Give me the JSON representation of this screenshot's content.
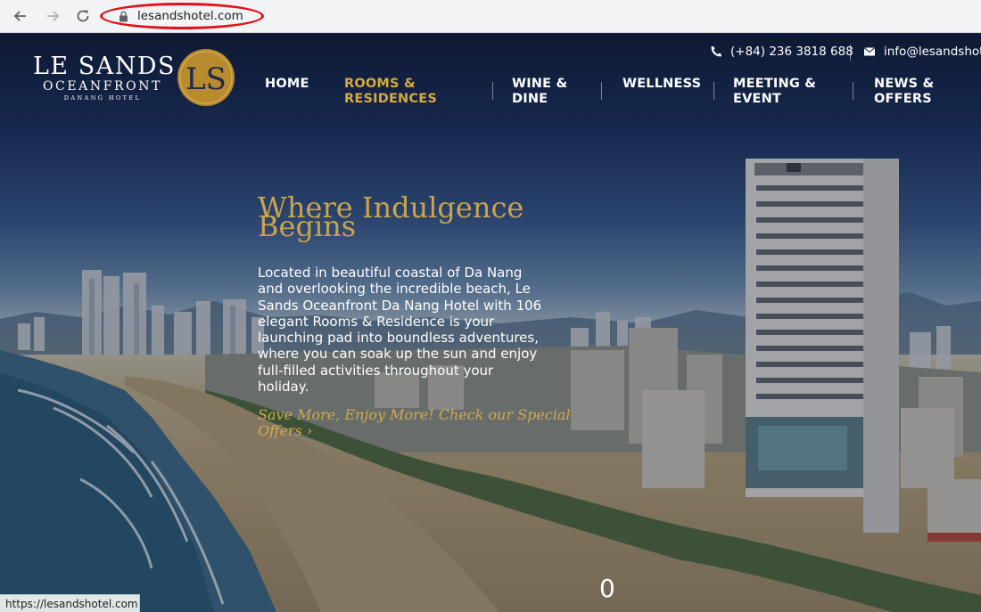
{
  "browser": {
    "url": "lesandshotel.com",
    "status_link": "https://lesandshotel.com"
  },
  "contact": {
    "phone": "(+84) 236 3818 688",
    "email": "info@lesandshotel.com"
  },
  "logo": {
    "line1": "LE SANDS",
    "line2": "OCEANFRONT",
    "line3": "DANANG HOTEL",
    "emblem_letters": "LS"
  },
  "nav": {
    "items": [
      {
        "line1": "HOME",
        "line2": ""
      },
      {
        "line1": "ROOMS &",
        "line2": "RESIDENCES"
      },
      {
        "line1": "WINE &",
        "line2": "DINE"
      },
      {
        "line1": "WELLNESS",
        "line2": ""
      },
      {
        "line1": "MEETING &",
        "line2": "EVENT"
      },
      {
        "line1": "NEWS &",
        "line2": "OFFERS"
      }
    ],
    "active_index": 1
  },
  "hero": {
    "title_lines": [
      "Where Indulgence",
      "Begins"
    ],
    "description_lines": [
      "Located in beautiful coastal of Da Nang",
      "and overlooking the incredible beach, Le",
      "Sands Oceanfront Da Nang Hotel with 106",
      "elegant Rooms & Residence is your",
      "launching pad into boundless adventures,",
      "where you can soak up the sun and enjoy",
      "full-filled activities throughout your",
      "holiday."
    ],
    "offers_lines": [
      "Save More, Enjoy More! Check our Special",
      "Offers ›"
    ],
    "slide_indicator": "0"
  },
  "colors": {
    "accent_gold": "#d8a93c",
    "url_highlight": "#e3101a"
  }
}
